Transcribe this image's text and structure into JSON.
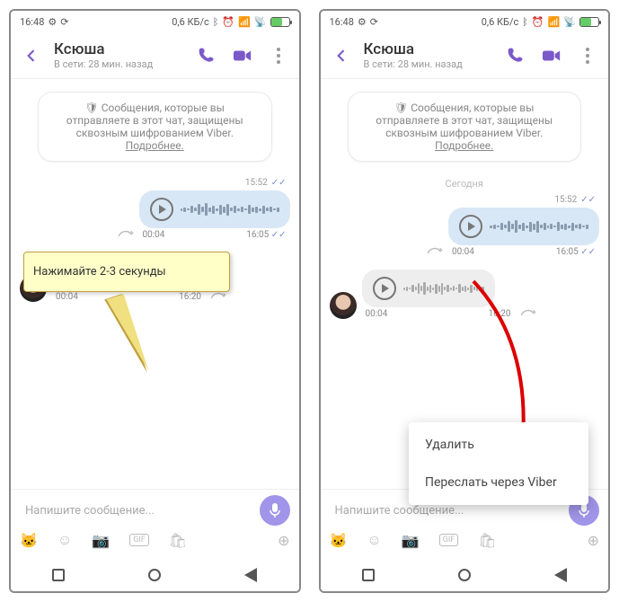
{
  "status": {
    "time": "16:48",
    "data_rate": "0,6 КБ/с",
    "battery_pct": "62"
  },
  "header": {
    "name": "Ксюша",
    "status": "В сети: 28 мин. назад"
  },
  "notice": {
    "text": "Сообщения, которые вы отправляете в этот чат, защищены сквозным шифрованием Viber.",
    "more": "Подробнее."
  },
  "date_separator": "Сегодня",
  "messages": {
    "sent1": {
      "time": "15:52",
      "dur_start": "00:04",
      "dur_end": "16:05"
    },
    "recv1": {
      "dur_start": "00:04",
      "dur_end": "16:20"
    }
  },
  "callout": {
    "text": "Нажимайте 2-3 секунды"
  },
  "context_menu": {
    "delete": "Удалить",
    "forward": "Переслать через Viber"
  },
  "input": {
    "placeholder": "Напишите сообщение..."
  },
  "icons": {
    "back": "back-arrow-icon",
    "call": "phone-icon",
    "video": "video-icon",
    "more": "more-icon",
    "shield": "shield-icon",
    "play": "play-icon",
    "share": "share-icon",
    "check": "double-check-icon",
    "mic": "mic-icon",
    "cat": "sticker-icon",
    "smile": "emoji-icon",
    "camera": "camera-icon",
    "gif": "gif-icon",
    "shop": "shop-icon",
    "plus": "plus-icon"
  }
}
